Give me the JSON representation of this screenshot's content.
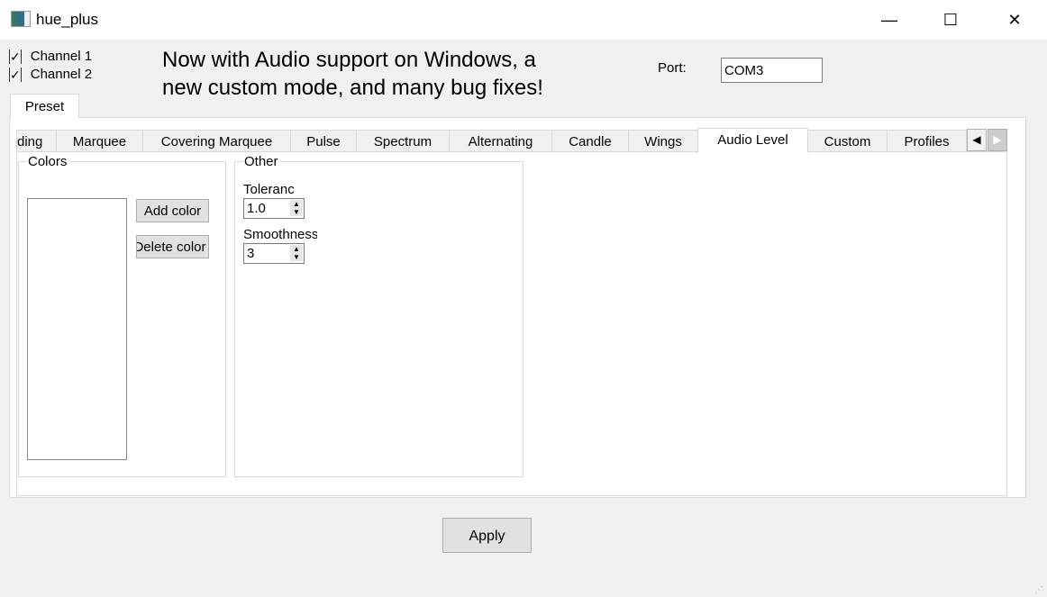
{
  "window": {
    "title": "hue_plus",
    "icon": "app-icon",
    "controls": [
      "minimize",
      "maximize",
      "close"
    ]
  },
  "channels": [
    {
      "label": "Channel 1",
      "checked": true
    },
    {
      "label": "Channel 2",
      "checked": true
    }
  ],
  "announcement": {
    "line1": "Now with Audio support on Windows, a",
    "line2": "new custom mode, and many bug fixes!"
  },
  "port": {
    "label": "Port:",
    "value": "COM3"
  },
  "outer_tabs": [
    {
      "label": "Preset",
      "selected": true
    }
  ],
  "tabs": [
    {
      "label": "ding"
    },
    {
      "label": "Marquee"
    },
    {
      "label": "Covering Marquee"
    },
    {
      "label": "Pulse"
    },
    {
      "label": "Spectrum"
    },
    {
      "label": "Alternating"
    },
    {
      "label": "Candle"
    },
    {
      "label": "Wings"
    },
    {
      "label": "Audio Level",
      "selected": true
    },
    {
      "label": "Custom"
    },
    {
      "label": "Profiles"
    }
  ],
  "colors_group": {
    "title": "Colors",
    "add": "Add color",
    "delete": "Delete color"
  },
  "other_group": {
    "title": "Other",
    "tolerance_label": "Toleranc",
    "tolerance_value": "1.0",
    "smoothness_label": "Smoothness",
    "smoothness_value": "3"
  },
  "apply": "Apply"
}
